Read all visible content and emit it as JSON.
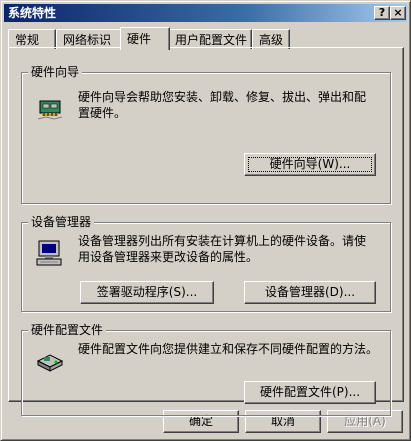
{
  "window": {
    "title": "系统特性",
    "help_button": "?",
    "close_button": "×"
  },
  "tabs": [
    {
      "label": "常规",
      "active": false
    },
    {
      "label": "网络标识",
      "active": false
    },
    {
      "label": "硬件",
      "active": true
    },
    {
      "label": "用户配置文件",
      "active": false
    },
    {
      "label": "高级",
      "active": false
    }
  ],
  "hardware_wizard": {
    "title": "硬件向导",
    "description_line1": "硬件向导会帮助您安装、卸载、修复、拔出、弹出和配",
    "description_line2": "置硬件。",
    "button": "硬件向导(W)..."
  },
  "device_manager": {
    "title": "设备管理器",
    "description_line1": "设备管理器列出所有安装在计算机上的硬件设备。请使",
    "description_line2": "用设备管理器来更改设备的属性。",
    "signing_button": "签署驱动程序(S)...",
    "manager_button": "设备管理器(D)..."
  },
  "hardware_profiles": {
    "title": "硬件配置文件",
    "description": "硬件配置文件向您提供建立和保存不同硬件配置的方法。",
    "button": "硬件配置文件(P)..."
  },
  "footer": {
    "ok": "确定",
    "cancel": "取消",
    "apply": "应用(A)"
  },
  "icons": {
    "wizard": "hardware-wizard-icon",
    "device_manager": "computer-icon",
    "profiles": "hardware-profile-icon"
  }
}
